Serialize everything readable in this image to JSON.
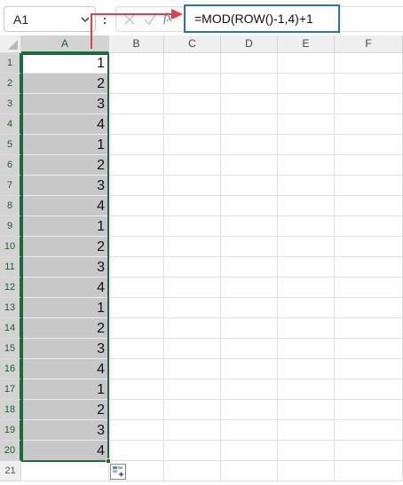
{
  "formula_bar": {
    "name_box": "A1",
    "fx_label": "fx",
    "formula": "=MOD(ROW()-1,4)+1"
  },
  "columns": [
    "A",
    "B",
    "C",
    "D",
    "E",
    "F"
  ],
  "rows": [
    {
      "num": "1",
      "a": "1"
    },
    {
      "num": "2",
      "a": "2"
    },
    {
      "num": "3",
      "a": "3"
    },
    {
      "num": "4",
      "a": "4"
    },
    {
      "num": "5",
      "a": "1"
    },
    {
      "num": "6",
      "a": "2"
    },
    {
      "num": "7",
      "a": "3"
    },
    {
      "num": "8",
      "a": "4"
    },
    {
      "num": "9",
      "a": "1"
    },
    {
      "num": "10",
      "a": "2"
    },
    {
      "num": "11",
      "a": "3"
    },
    {
      "num": "12",
      "a": "4"
    },
    {
      "num": "13",
      "a": "1"
    },
    {
      "num": "14",
      "a": "2"
    },
    {
      "num": "15",
      "a": "3"
    },
    {
      "num": "16",
      "a": "4"
    },
    {
      "num": "17",
      "a": "1"
    },
    {
      "num": "18",
      "a": "2"
    },
    {
      "num": "19",
      "a": "3"
    },
    {
      "num": "20",
      "a": "4"
    },
    {
      "num": "21",
      "a": ""
    }
  ],
  "colors": {
    "selection_green": "#1d6b3a",
    "annotation_red": "#d9434b",
    "formula_highlight": "#2f6fbf",
    "selected_fill": "#c8c8c8"
  },
  "icons": {
    "name_box_dropdown": "chevron-down-icon",
    "cancel": "close-icon",
    "confirm": "checkmark-icon",
    "function": "fx-icon",
    "quick_analysis": "quick-analysis-icon"
  }
}
